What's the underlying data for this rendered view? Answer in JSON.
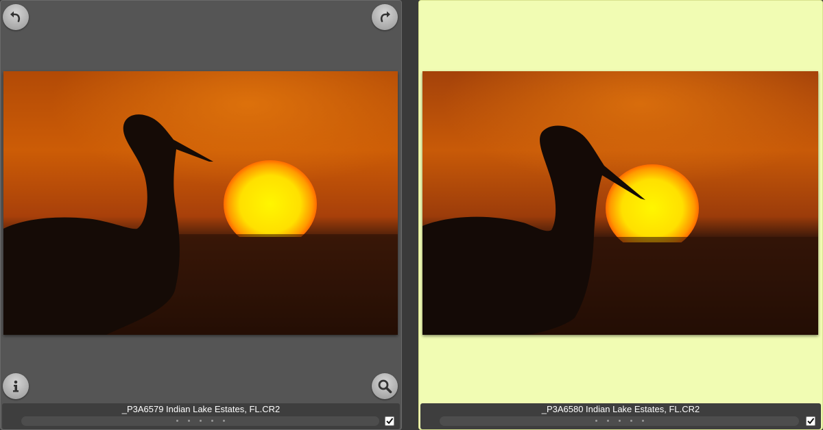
{
  "colors": {
    "left_panel_bg": "#555555",
    "right_panel_bg": "#f1fcb3",
    "footer_bg": "#3e3e3e",
    "window_bg": "#3a3a3a"
  },
  "left_panel": {
    "filename": "_P3A6579 Indian Lake Estates, FL.CR2",
    "selected": false,
    "checked": true,
    "rating_dots": 5,
    "buttons": {
      "rotate_left_icon": "rotate-left-icon",
      "rotate_right_icon": "rotate-right-icon",
      "info_icon": "info-icon",
      "zoom_icon": "magnifier-icon"
    }
  },
  "right_panel": {
    "filename": "_P3A6580 Indian Lake Estates, FL.CR2",
    "selected": true,
    "checked": true,
    "rating_dots": 5
  }
}
